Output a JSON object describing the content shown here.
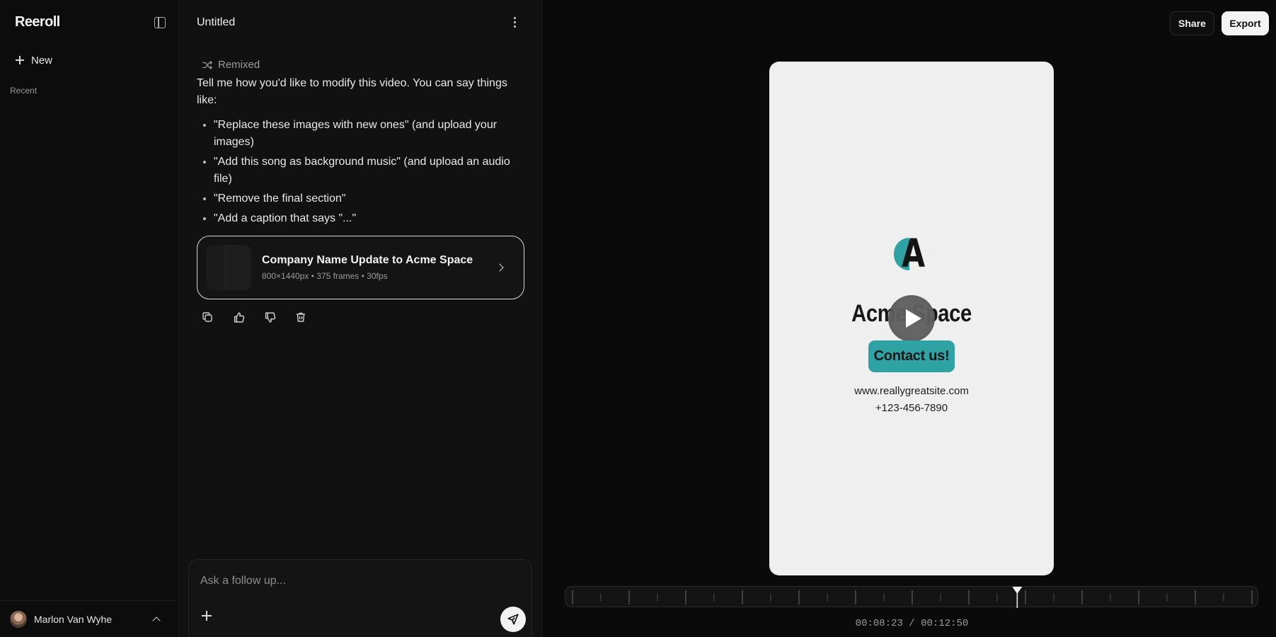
{
  "sidebar": {
    "brand": "Reeroll",
    "new_label": "New",
    "recent_label": "Recent",
    "user_name": "Marlon Van Wyhe"
  },
  "chat": {
    "title": "Untitled",
    "remixed_label": "Remixed",
    "intro": "Tell me how you'd like to modify this video. You can say things like:",
    "tips": [
      "\"Replace these images with new ones\" (and upload your images)",
      "\"Add this song as background music\" (and upload an audio file)",
      "\"Remove the final section\"",
      "\"Add a caption that says \"...\""
    ],
    "card": {
      "title": "Company Name Update to Acme Space",
      "meta": "800×1440px • 375 frames • 30fps"
    },
    "composer_placeholder": "Ask a follow up..."
  },
  "header": {
    "share_label": "Share",
    "export_label": "Export"
  },
  "video": {
    "logo_letter": "A",
    "company_name": "Acme Space",
    "cta": "Contact us!",
    "website": "www.reallygreatsite.com",
    "phone": "+123-456-7890",
    "accent_color": "#2fa3a3"
  },
  "timeline": {
    "current": "00:08:23",
    "total": "00:12:50",
    "timecode": "00:08:23 / 00:12:50",
    "progress": 0.6545
  }
}
